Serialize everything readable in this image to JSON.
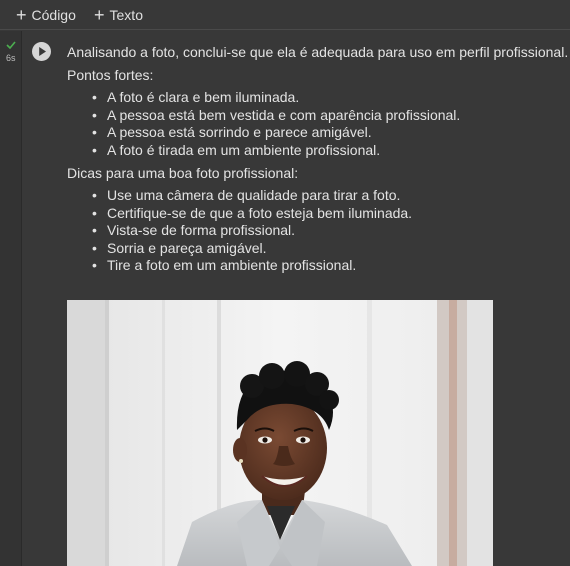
{
  "toolbar": {
    "add_code_label": "Código",
    "add_text_label": "Texto"
  },
  "cell": {
    "execution_time": "6s",
    "status": "success",
    "output": {
      "intro": "Analisando a foto, conclui-se que ela é adequada para uso em perfil profissional.",
      "strengths_heading": "Pontos fortes:",
      "strengths": [
        "A foto é clara e bem iluminada.",
        "A pessoa está bem vestida e com aparência profissional.",
        "A pessoa está sorrindo e parece amigável.",
        "A foto é tirada em um ambiente profissional."
      ],
      "tips_heading": "Dicas para uma boa foto profissional:",
      "tips": [
        "Use uma câmera de qualidade para tirar a foto.",
        "Certifique-se de que a foto esteja bem iluminada.",
        "Vista-se de forma profissional.",
        "Sorria e pareça amigável.",
        "Tire a foto em um ambiente profissional."
      ]
    }
  },
  "colors": {
    "background": "#383838",
    "text": "#e3e3e3",
    "success": "#4caf50"
  },
  "icons": {
    "add": "plus-icon",
    "run": "play-icon",
    "status": "check-icon"
  }
}
